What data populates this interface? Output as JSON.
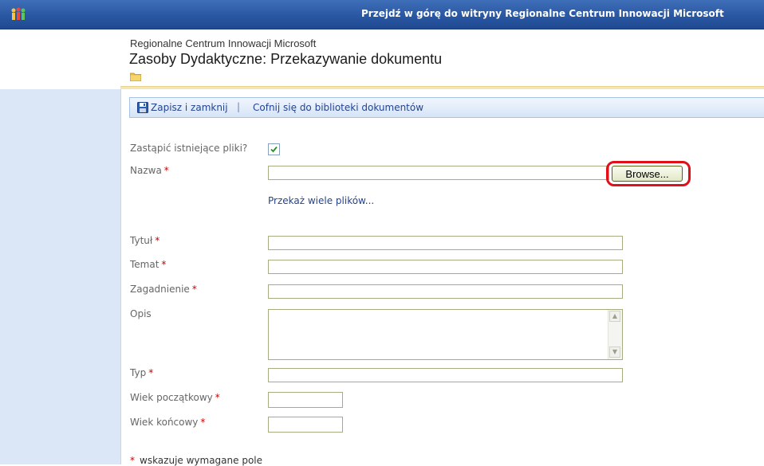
{
  "topbar": {
    "link_text": "Przejdź w górę do witryny Regionalne Centrum Innowacji Microsoft"
  },
  "header": {
    "site_name": "Regionalne Centrum Innowacji Microsoft",
    "page_title": "Zasoby Dydaktyczne: Przekazywanie dokumentu"
  },
  "toolbar": {
    "save_label": "Zapisz i zamknij",
    "separator": "|",
    "back_label": "Cofnij się do biblioteki dokumentów"
  },
  "form": {
    "overwrite_label": "Zastąpić istniejące pliki?",
    "overwrite_checked": true,
    "name_label": "Nazwa",
    "browse_label": "Browse...",
    "multi_upload_label": "Przekaż wiele plików...",
    "title_label": "Tytuł",
    "subject_label": "Temat",
    "topic_label": "Zagadnienie",
    "description_label": "Opis",
    "type_label": "Typ",
    "age_start_label": "Wiek początkowy",
    "age_end_label": "Wiek końcowy",
    "required_marker": "*",
    "footnote": "wskazuje wymagane pole"
  },
  "colors": {
    "topbar": "#2a57a2",
    "link": "#24448f",
    "required": "#cc0000",
    "highlight": "#e0101a"
  }
}
